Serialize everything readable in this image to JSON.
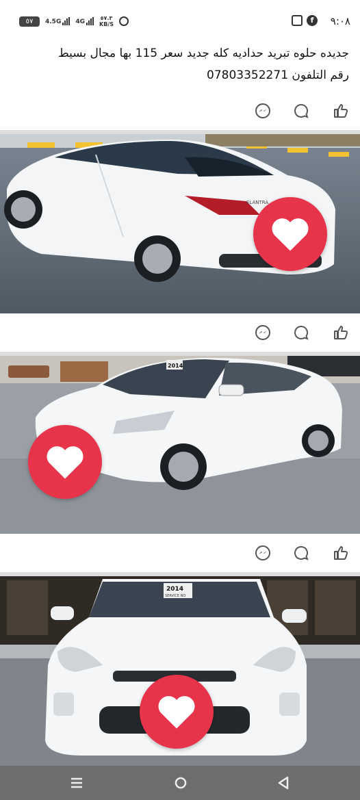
{
  "status_bar": {
    "time": "٩:٠٨",
    "battery": "٥٧",
    "network_1": "4.5G",
    "network_2": "4G",
    "speed_value": "٥٧.٣",
    "speed_unit": "KB/S"
  },
  "post": {
    "text_line_1": "جديده حلوه تبريد حداديه كله جديد سعر 115 بها مجال بسيط",
    "text_line_2": "رقم التلفون 07803352271"
  },
  "actions": {
    "like_icon": "thumbs-up-icon",
    "comment_icon": "comment-icon",
    "share_icon": "messenger-icon"
  },
  "photos": [
    {
      "subject": "white-sedan-rear-three-quarter",
      "reaction": "heart"
    },
    {
      "subject": "white-sedan-front-three-quarter",
      "reaction": "heart",
      "windshield_sticker": "2014"
    },
    {
      "subject": "white-sedan-front",
      "reaction": "heart",
      "windshield_sticker": "2014",
      "sticker_sub": "SERVICE NO"
    }
  ],
  "car_badge": "ELANTRA",
  "colors": {
    "heart_badge": "#e8344a",
    "nav_bar": "#6e6e6e",
    "separator": "#dddddd"
  },
  "nav_bar": {
    "menu_icon": "recent-apps-icon",
    "home_icon": "home-icon",
    "back_icon": "back-icon"
  }
}
